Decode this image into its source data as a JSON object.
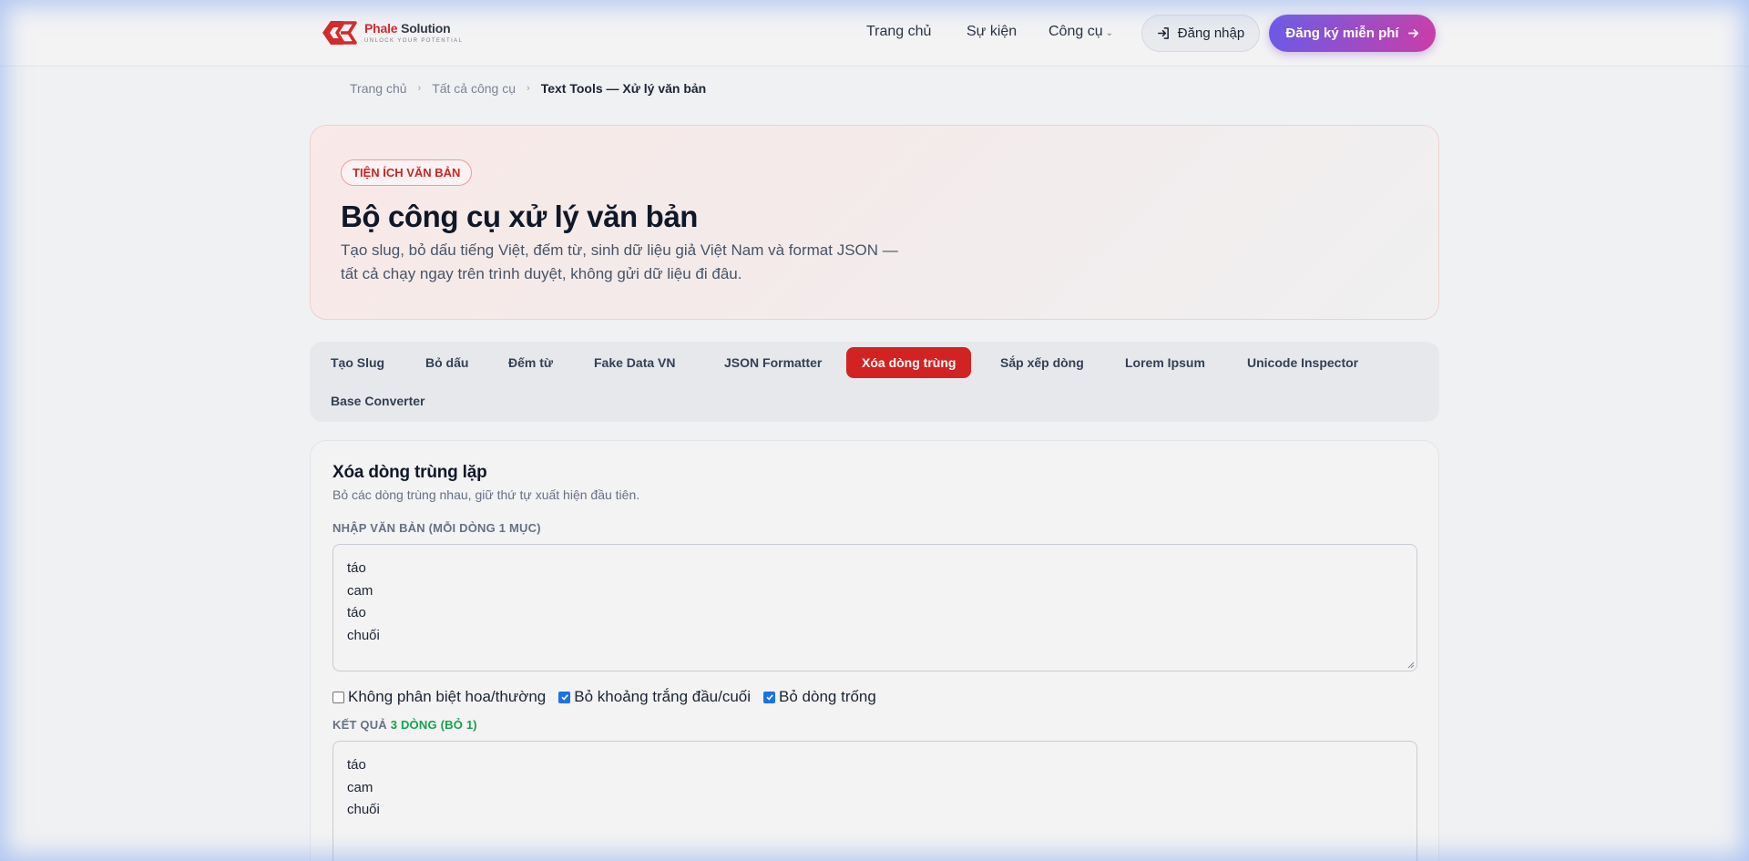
{
  "header": {
    "logo": {
      "name_part1": "Phale",
      "name_part2": "Solution",
      "tagline": "UNLOCK YOUR POTENTIAL"
    },
    "nav": [
      {
        "label": "Trang chủ"
      },
      {
        "label": "Sự kiện"
      },
      {
        "label": "Công cụ"
      }
    ],
    "login_label": "Đăng nhập",
    "signup_label": "Đăng ký miễn phí"
  },
  "breadcrumb": [
    "Trang chủ",
    "Tất cả công cụ",
    "Text Tools — Xử lý văn bản"
  ],
  "hero": {
    "badge": "TIỆN ÍCH VĂN BẢN",
    "title": "Bộ công cụ xử lý văn bản",
    "description": "Tạo slug, bỏ dấu tiếng Việt, đếm từ, sinh dữ liệu giả Việt Nam và format JSON — tất cả chạy ngay trên trình duyệt, không gửi dữ liệu đi đâu."
  },
  "tabs": [
    {
      "label": "Tạo Slug"
    },
    {
      "label": "Bỏ dấu"
    },
    {
      "label": "Đếm từ"
    },
    {
      "label": "Fake Data VN"
    },
    {
      "label": "JSON Formatter"
    },
    {
      "label": "Xóa dòng trùng",
      "active": true
    },
    {
      "label": "Sắp xếp dòng"
    },
    {
      "label": "Lorem Ipsum"
    },
    {
      "label": "Unicode Inspector"
    },
    {
      "label": "Base Converter"
    }
  ],
  "tool": {
    "title": "Xóa dòng trùng lặp",
    "description": "Bỏ các dòng trùng nhau, giữ thứ tự xuất hiện đầu tiên.",
    "input_label": "NHẬP VĂN BẢN (MỖI DÒNG 1 MỤC)",
    "input_lines": [
      "táo",
      "cam",
      "táo",
      "chuối"
    ],
    "options": [
      {
        "label": "Không phân biệt hoa/thường",
        "checked": false
      },
      {
        "label": "Bỏ khoảng trắng đầu/cuối",
        "checked": true
      },
      {
        "label": "Bỏ dòng trống",
        "checked": true
      }
    ],
    "result_label": "KẾT QUẢ",
    "result_stats": "3 DÒNG (BỎ 1)",
    "output_lines": [
      "táo",
      "cam",
      "chuối"
    ]
  },
  "colors": {
    "accent": "#d32222",
    "signup_gradient_start": "#6d5ae6",
    "signup_gradient_end": "#c93ea8",
    "result_green": "#16a34a"
  }
}
